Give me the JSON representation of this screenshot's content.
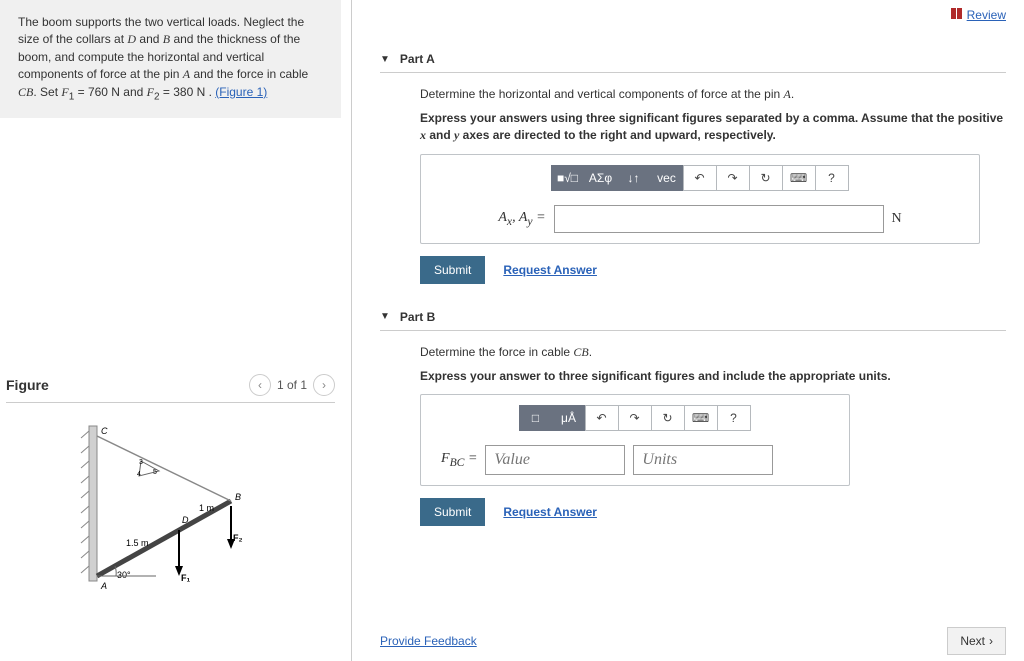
{
  "review_label": "Review",
  "problem": {
    "prefix": "The boom supports the two vertical loads. Neglect the size of the collars at ",
    "D": "D",
    "text1": " and ",
    "B": "B",
    "text2": " and the thickness of the boom, and compute the horizontal and vertical components of force at the pin ",
    "A": "A",
    "text3": " and the force in cable ",
    "CB": "CB",
    "text4": ". Set ",
    "F1lbl": "F",
    "sub1": "1",
    "text5": " = 760 N and ",
    "F2lbl": "F",
    "sub2": "2",
    "text6": " = 380 N . ",
    "figlink": "(Figure 1)"
  },
  "figure": {
    "title": "Figure",
    "nav_count": "1 of 1",
    "dim1": "1 m",
    "dim2": "1.5 m",
    "angle": "30°",
    "label_A": "A",
    "label_B": "B",
    "label_C": "C",
    "label_D": "D",
    "label_F1": "F₁",
    "label_F2": "F₂",
    "small3": "3",
    "small4": "4",
    "small5": "5"
  },
  "partA": {
    "label": "Part A",
    "question_pre": "Determine the horizontal and vertical components of force at the pin ",
    "question_var": "A",
    "question_post": ".",
    "instruction_pre": "Express your answers using three significant figures separated by a comma. Assume that the positive ",
    "instr_x": "x",
    "instr_mid": " and ",
    "instr_y": "y",
    "instr_post": " axes are directed to the right and upward, respectively.",
    "toolbar": {
      "b0": "■√□",
      "b1": "ΑΣφ",
      "b2": "↓↑",
      "b3": "vec",
      "b4": "↶",
      "b5": "↷",
      "b6": "↻",
      "b7": "⌨",
      "b8": "?"
    },
    "var_pre": "A",
    "var_sub_x": "x",
    "var_comma": ", ",
    "var_sub_y": "y",
    "var_eq": " = ",
    "unit": "N",
    "submit": "Submit",
    "request": "Request Answer"
  },
  "partB": {
    "label": "Part B",
    "question_pre": "Determine the force in cable ",
    "question_var": "CB",
    "question_post": ".",
    "instruction": "Express your answer to three significant figures and include the appropriate units.",
    "toolbar": {
      "b0": "□",
      "b1": "μÅ",
      "b2": "↶",
      "b3": "↷",
      "b4": "↻",
      "b5": "⌨",
      "b6": "?"
    },
    "var_F": "F",
    "var_sub": "BC",
    "var_eq": " = ",
    "value_placeholder": "Value",
    "units_placeholder": "Units",
    "submit": "Submit",
    "request": "Request Answer"
  },
  "provide_feedback": "Provide Feedback",
  "next": "Next"
}
